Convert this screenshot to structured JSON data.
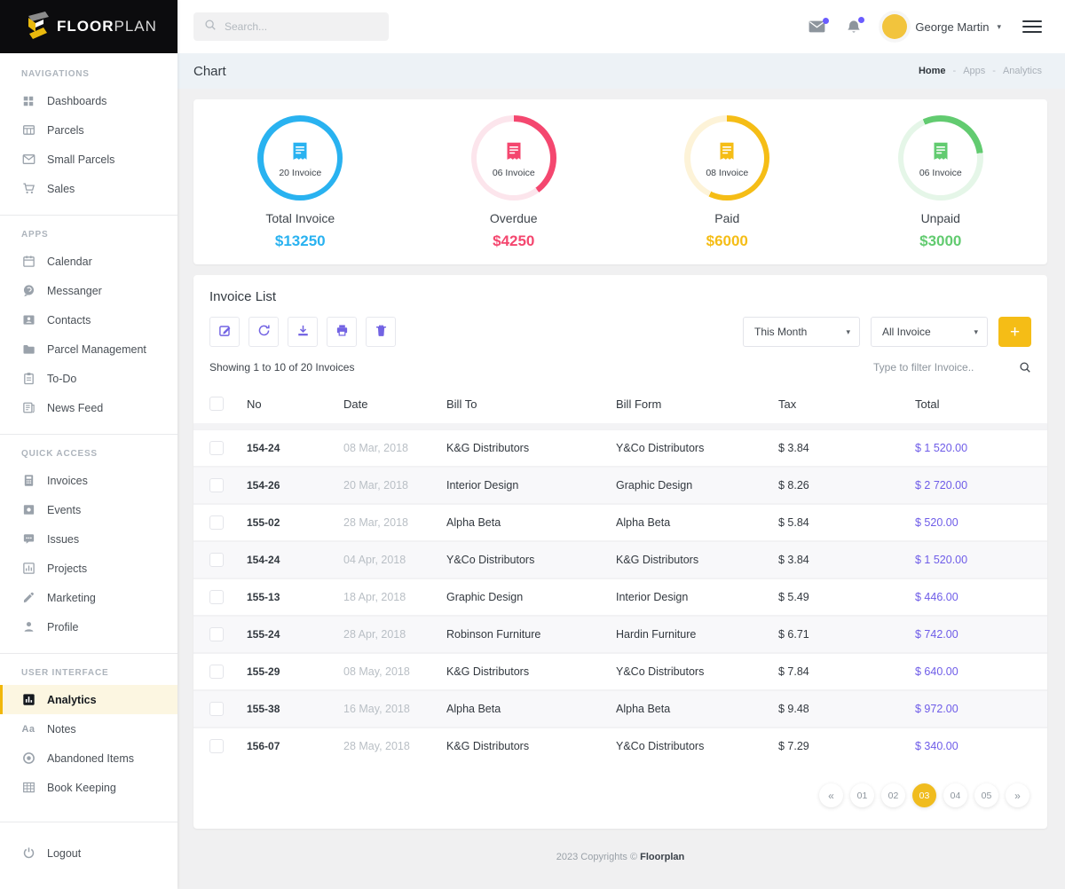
{
  "brand": {
    "name_bold": "FLOOR",
    "name_light": "PLAN"
  },
  "topbar": {
    "search_placeholder": "Search...",
    "icons": [
      "mail-icon",
      "bell-icon",
      "hamburger-icon"
    ],
    "user": {
      "name": "George Martin",
      "avatar_color": "#f2c43d"
    }
  },
  "page_header": {
    "title": "Chart",
    "breadcrumb": {
      "items": [
        "Home",
        "Apps",
        "Analytics"
      ],
      "separator": "-"
    }
  },
  "sidebar": {
    "sections": [
      {
        "label": "NAVIGATIONS",
        "items": [
          {
            "label": "Dashboards",
            "icon": "dashboard-grid-icon"
          },
          {
            "label": "Parcels",
            "icon": "parcels-table-icon"
          },
          {
            "label": "Small Parcels",
            "icon": "envelope-icon"
          },
          {
            "label": "Sales",
            "icon": "cart-icon"
          }
        ]
      },
      {
        "label": "APPS",
        "items": [
          {
            "label": "Calendar",
            "icon": "calendar-icon"
          },
          {
            "label": "Messanger",
            "icon": "chat-bubble-icon"
          },
          {
            "label": "Contacts",
            "icon": "contact-card-icon"
          },
          {
            "label": "Parcel Management",
            "icon": "folder-icon"
          },
          {
            "label": "To-Do",
            "icon": "clipboard-icon"
          },
          {
            "label": "News Feed",
            "icon": "news-icon"
          }
        ]
      },
      {
        "label": "QUICK ACCESS",
        "items": [
          {
            "label": "Invoices",
            "icon": "invoice-calc-icon"
          },
          {
            "label": "Events",
            "icon": "event-icon"
          },
          {
            "label": "Issues",
            "icon": "issues-chat-icon"
          },
          {
            "label": "Projects",
            "icon": "projects-chart-icon"
          },
          {
            "label": "Marketing",
            "icon": "marketing-pen-icon"
          },
          {
            "label": "Profile",
            "icon": "person-icon"
          }
        ]
      },
      {
        "label": "USER INTERFACE",
        "items": [
          {
            "label": "Analytics",
            "icon": "analytics-bars-icon",
            "active": true
          },
          {
            "label": "Notes",
            "icon": "aa-text-icon"
          },
          {
            "label": "Abandoned Items",
            "icon": "ban-circle-icon"
          },
          {
            "label": "Book Keeping",
            "icon": "book-grid-icon"
          }
        ]
      }
    ],
    "logout": {
      "label": "Logout",
      "icon": "power-icon"
    }
  },
  "stats": {
    "items": [
      {
        "count": "20 Invoice",
        "label": "Total Invoice",
        "value": "$13250",
        "color": "#29b2f0",
        "pale": "#d4effc",
        "ring_percent": 100,
        "ring_start_deg": 0,
        "icon": "invoice-bill-icon"
      },
      {
        "count": "06 Invoice",
        "label": "Overdue",
        "value": "$4250",
        "color": "#f4476f",
        "pale": "#fce5ec",
        "ring_percent": 40,
        "ring_start_deg": 0,
        "icon": "invoice-bill-icon"
      },
      {
        "count": "08 Invoice",
        "label": "Paid",
        "value": "$6000",
        "color": "#f5bd16",
        "pale": "#fdf3d8",
        "ring_percent": 57,
        "ring_start_deg": 0,
        "icon": "invoice-bill-icon"
      },
      {
        "count": "06 Invoice",
        "label": "Unpaid",
        "value": "$3000",
        "color": "#62cb70",
        "pale": "#e5f6e8",
        "ring_percent": 30,
        "ring_start_deg": -25,
        "icon": "invoice-bill-icon"
      }
    ]
  },
  "invoice": {
    "title": "Invoice List",
    "toolbar": {
      "buttons": [
        {
          "name": "edit-button",
          "icon": "edit-icon"
        },
        {
          "name": "refresh-button",
          "icon": "refresh-icon"
        },
        {
          "name": "download-button",
          "icon": "download-icon"
        },
        {
          "name": "print-button",
          "icon": "print-icon"
        },
        {
          "name": "delete-button",
          "icon": "trash-icon"
        }
      ],
      "period_filter": "This Month",
      "type_filter": "All Invoice",
      "add_label": "+"
    },
    "showing": "Showing 1 to 10 of 20 Invoices",
    "filter_placeholder": "Type to filter Invoice..",
    "table": {
      "columns": [
        "No",
        "Date",
        "Bill To",
        "Bill Form",
        "Tax",
        "Total"
      ],
      "rows": [
        {
          "no": "154-24",
          "date": "08 Mar, 2018",
          "bill_to": "K&G Distributors",
          "bill_form": "Y&Co Distributors",
          "tax": "$ 3.84",
          "total": "$ 1 520.00"
        },
        {
          "no": "154-26",
          "date": "20 Mar, 2018",
          "bill_to": "Interior Design",
          "bill_form": "Graphic Design",
          "tax": "$ 8.26",
          "total": "$ 2 720.00"
        },
        {
          "no": "155-02",
          "date": "28 Mar, 2018",
          "bill_to": "Alpha Beta",
          "bill_form": "Alpha Beta",
          "tax": "$ 5.84",
          "total": "$ 520.00"
        },
        {
          "no": "154-24",
          "date": "04 Apr, 2018",
          "bill_to": "Y&Co Distributors",
          "bill_form": "K&G Distributors",
          "tax": "$ 3.84",
          "total": "$ 1 520.00"
        },
        {
          "no": "155-13",
          "date": "18 Apr, 2018",
          "bill_to": "Graphic Design",
          "bill_form": "Interior Design",
          "tax": "$ 5.49",
          "total": "$ 446.00"
        },
        {
          "no": "155-24",
          "date": "28 Apr, 2018",
          "bill_to": "Robinson Furniture",
          "bill_form": "Hardin Furniture",
          "tax": "$ 6.71",
          "total": "$ 742.00"
        },
        {
          "no": "155-29",
          "date": "08 May, 2018",
          "bill_to": "K&G Distributors",
          "bill_form": "Y&Co Distributors",
          "tax": "$ 7.84",
          "total": "$ 640.00"
        },
        {
          "no": "155-38",
          "date": "16 May, 2018",
          "bill_to": "Alpha Beta",
          "bill_form": "Alpha Beta",
          "tax": "$ 9.48",
          "total": "$ 972.00"
        },
        {
          "no": "156-07",
          "date": "28 May, 2018",
          "bill_to": "K&G Distributors",
          "bill_form": "Y&Co Distributors",
          "tax": "$ 7.29",
          "total": "$ 340.00"
        }
      ]
    },
    "pagination": {
      "prev": "«",
      "pages": [
        "01",
        "02",
        "03",
        "04",
        "05"
      ],
      "active": "03",
      "next": "»"
    }
  },
  "footer": {
    "text": "2023 Copyrights ©",
    "brand": "Floorplan"
  },
  "colors": {
    "accent_yellow": "#f5bd16",
    "accent_purple": "#6e5ce8",
    "badge_dot": "#6a5cff",
    "blue": "#29b2f0",
    "pink": "#f4476f",
    "green": "#62cb70",
    "header_bg": "#edf2f6"
  }
}
